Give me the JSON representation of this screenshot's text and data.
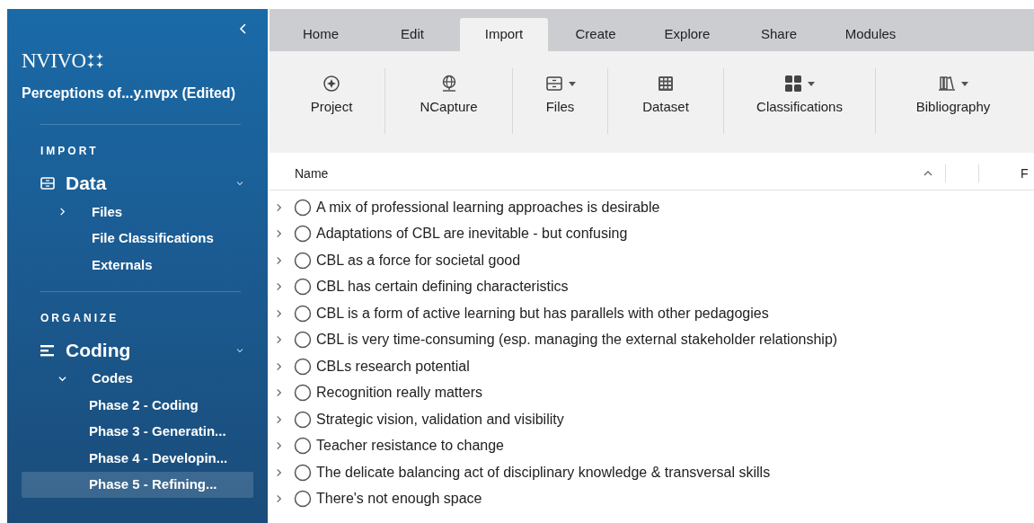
{
  "sidebar": {
    "logo": "NVIVO",
    "project": "Perceptions of...y.nvpx (Edited)",
    "sections": [
      {
        "heading": "IMPORT",
        "group": {
          "label": "Data",
          "kind": "data",
          "expanded": true
        },
        "items": [
          {
            "label": "Files",
            "expanded": false,
            "has_children": true,
            "selected": false
          },
          {
            "label": "File Classifications",
            "has_children": false,
            "selected": false
          },
          {
            "label": "Externals",
            "has_children": false,
            "selected": false
          }
        ]
      },
      {
        "heading": "ORGANIZE",
        "group": {
          "label": "Coding",
          "kind": "coding",
          "expanded": true
        },
        "items": [
          {
            "label": "Codes",
            "expanded": true,
            "has_children": true,
            "selected": false,
            "children": [
              {
                "label": "Phase 2 - Coding",
                "selected": false
              },
              {
                "label": "Phase 3 - Generatin...",
                "selected": false
              },
              {
                "label": "Phase 4 - Developin...",
                "selected": false
              },
              {
                "label": "Phase 5 - Refining...",
                "selected": true
              }
            ]
          }
        ]
      }
    ]
  },
  "tabs": [
    {
      "label": "Home",
      "selected": false
    },
    {
      "label": "Edit",
      "selected": false
    },
    {
      "label": "Import",
      "selected": true
    },
    {
      "label": "Create",
      "selected": false
    },
    {
      "label": "Explore",
      "selected": false
    },
    {
      "label": "Share",
      "selected": false
    },
    {
      "label": "Modules",
      "selected": false
    }
  ],
  "ribbon": [
    {
      "label": "Project",
      "kind": "project",
      "dropdown": false
    },
    {
      "label": "NCapture",
      "kind": "globe",
      "dropdown": false
    },
    {
      "label": "Files",
      "kind": "files",
      "dropdown": true
    },
    {
      "label": "Dataset",
      "kind": "dataset",
      "dropdown": false
    },
    {
      "label": "Classifications",
      "kind": "classifications",
      "dropdown": true
    },
    {
      "label": "Bibliography",
      "kind": "bibliography",
      "dropdown": true
    }
  ],
  "table": {
    "columns": [
      "Name",
      "F"
    ],
    "sort_ascending": true,
    "rows": [
      {
        "name": "A mix of professional learning approaches is desirable",
        "expanded": false
      },
      {
        "name": "Adaptations of CBL are inevitable - but confusing",
        "expanded": false
      },
      {
        "name": "CBL as a force for societal good",
        "expanded": false
      },
      {
        "name": "CBL has certain defining characteristics",
        "expanded": false
      },
      {
        "name": "CBL is a form of active learning but has parallels with other pedagogies",
        "expanded": false
      },
      {
        "name": "CBL is very time-consuming (esp. managing the external stakeholder relationship)",
        "expanded": false
      },
      {
        "name": "CBLs research potential",
        "expanded": false
      },
      {
        "name": "Recognition really matters",
        "expanded": false
      },
      {
        "name": "Strategic vision, validation and visibility",
        "expanded": false
      },
      {
        "name": "Teacher resistance to change",
        "expanded": false
      },
      {
        "name": "The delicate balancing act of disciplinary knowledge & transversal skills",
        "expanded": false
      },
      {
        "name": "There's not enough space",
        "expanded": false
      }
    ]
  }
}
